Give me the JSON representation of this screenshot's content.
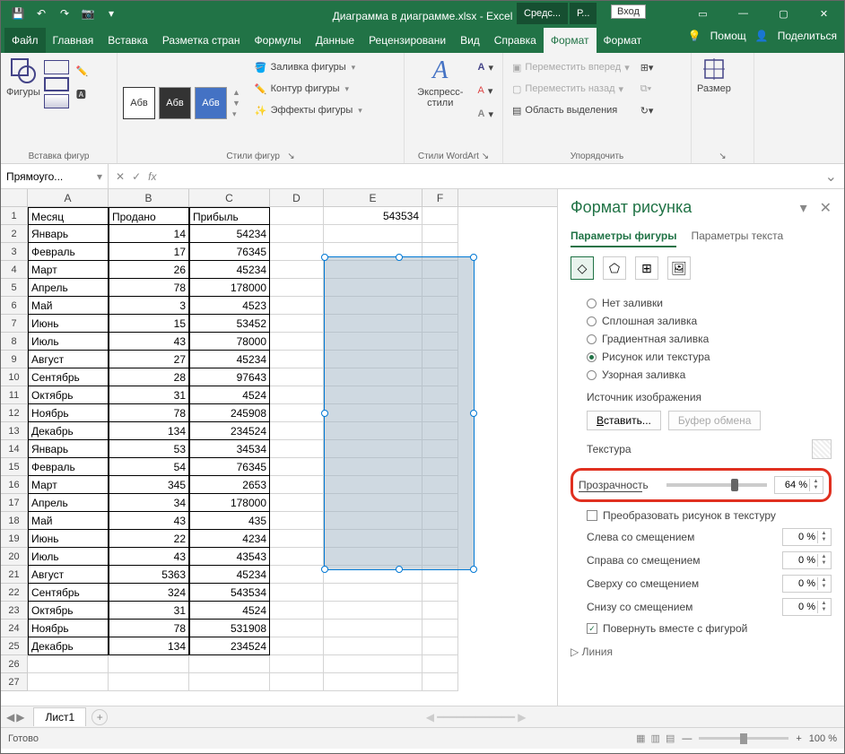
{
  "titlebar": {
    "filename": "Диаграмма в диаграмме.xlsx - Excel",
    "contextual": [
      "Средс...",
      "Р..."
    ],
    "login": "Вход"
  },
  "ribbon_tabs": {
    "file": "Файл",
    "tabs": [
      "Главная",
      "Вставка",
      "Разметка стран",
      "Формулы",
      "Данные",
      "Рецензировани",
      "Вид",
      "Справка",
      "Формат",
      "Формат"
    ],
    "active_index": 8,
    "help": "Помощ",
    "share": "Поделиться"
  },
  "ribbon": {
    "shapes_label": "Фигуры",
    "group1": "Вставка фигур",
    "style_items": [
      "Абв",
      "Абв",
      "Абв"
    ],
    "style_fill": "Заливка фигуры",
    "style_outline": "Контур фигуры",
    "style_effects": "Эффекты фигуры",
    "group2": "Стили фигур",
    "wordart_btn": "Экспресс-стили",
    "group3": "Стили WordArt",
    "forward": "Переместить вперед",
    "backward": "Переместить назад",
    "selection_pane": "Область выделения",
    "group4": "Упорядочить",
    "size": "Размер",
    "group5": ""
  },
  "namebox": {
    "value": "Прямоуго..."
  },
  "columns": [
    "A",
    "B",
    "C",
    "D",
    "E",
    "F"
  ],
  "cell_e1": "543534",
  "table": {
    "headers": [
      "Месяц",
      "Продано",
      "Прибыль"
    ],
    "rows": [
      [
        "Январь",
        "14",
        "54234"
      ],
      [
        "Февраль",
        "17",
        "76345"
      ],
      [
        "Март",
        "26",
        "45234"
      ],
      [
        "Апрель",
        "78",
        "178000"
      ],
      [
        "Май",
        "3",
        "4523"
      ],
      [
        "Июнь",
        "15",
        "53452"
      ],
      [
        "Июль",
        "43",
        "78000"
      ],
      [
        "Август",
        "27",
        "45234"
      ],
      [
        "Сентябрь",
        "28",
        "97643"
      ],
      [
        "Октябрь",
        "31",
        "4524"
      ],
      [
        "Ноябрь",
        "78",
        "245908"
      ],
      [
        "Декабрь",
        "134",
        "234524"
      ],
      [
        "Январь",
        "53",
        "34534"
      ],
      [
        "Февраль",
        "54",
        "76345"
      ],
      [
        "Март",
        "345",
        "2653"
      ],
      [
        "Апрель",
        "34",
        "178000"
      ],
      [
        "Май",
        "43",
        "435"
      ],
      [
        "Июнь",
        "22",
        "4234"
      ],
      [
        "Июль",
        "43",
        "43543"
      ],
      [
        "Август",
        "5363",
        "45234"
      ],
      [
        "Сентябрь",
        "324",
        "543534"
      ],
      [
        "Октябрь",
        "31",
        "4524"
      ],
      [
        "Ноябрь",
        "78",
        "531908"
      ],
      [
        "Декабрь",
        "134",
        "234524"
      ]
    ]
  },
  "pane": {
    "title": "Формат рисунка",
    "tab_shape": "Параметры фигуры",
    "tab_text": "Параметры текста",
    "fill": {
      "none": "Нет заливки",
      "solid": "Сплошная заливка",
      "gradient": "Градиентная заливка",
      "picture": "Рисунок или текстура",
      "pattern": "Узорная заливка"
    },
    "source_label": "Источник изображения",
    "insert_btn": "Вставить...",
    "clipboard_btn": "Буфер обмена",
    "texture_label": "Текстура",
    "transparency_label": "Прозрачность",
    "transparency_value": "64 %",
    "to_texture": "Преобразовать рисунок в текстуру",
    "offset_left": "Слева со смещением",
    "offset_right": "Справа со смещением",
    "offset_top": "Сверху со смещением",
    "offset_bottom": "Снизу со смещением",
    "offset_value": "0 %",
    "rotate_with": "Повернуть вместе с фигурой",
    "line_section": "Линия"
  },
  "sheet": {
    "name": "Лист1"
  },
  "status": {
    "ready": "Готово",
    "zoom": "100 %"
  }
}
